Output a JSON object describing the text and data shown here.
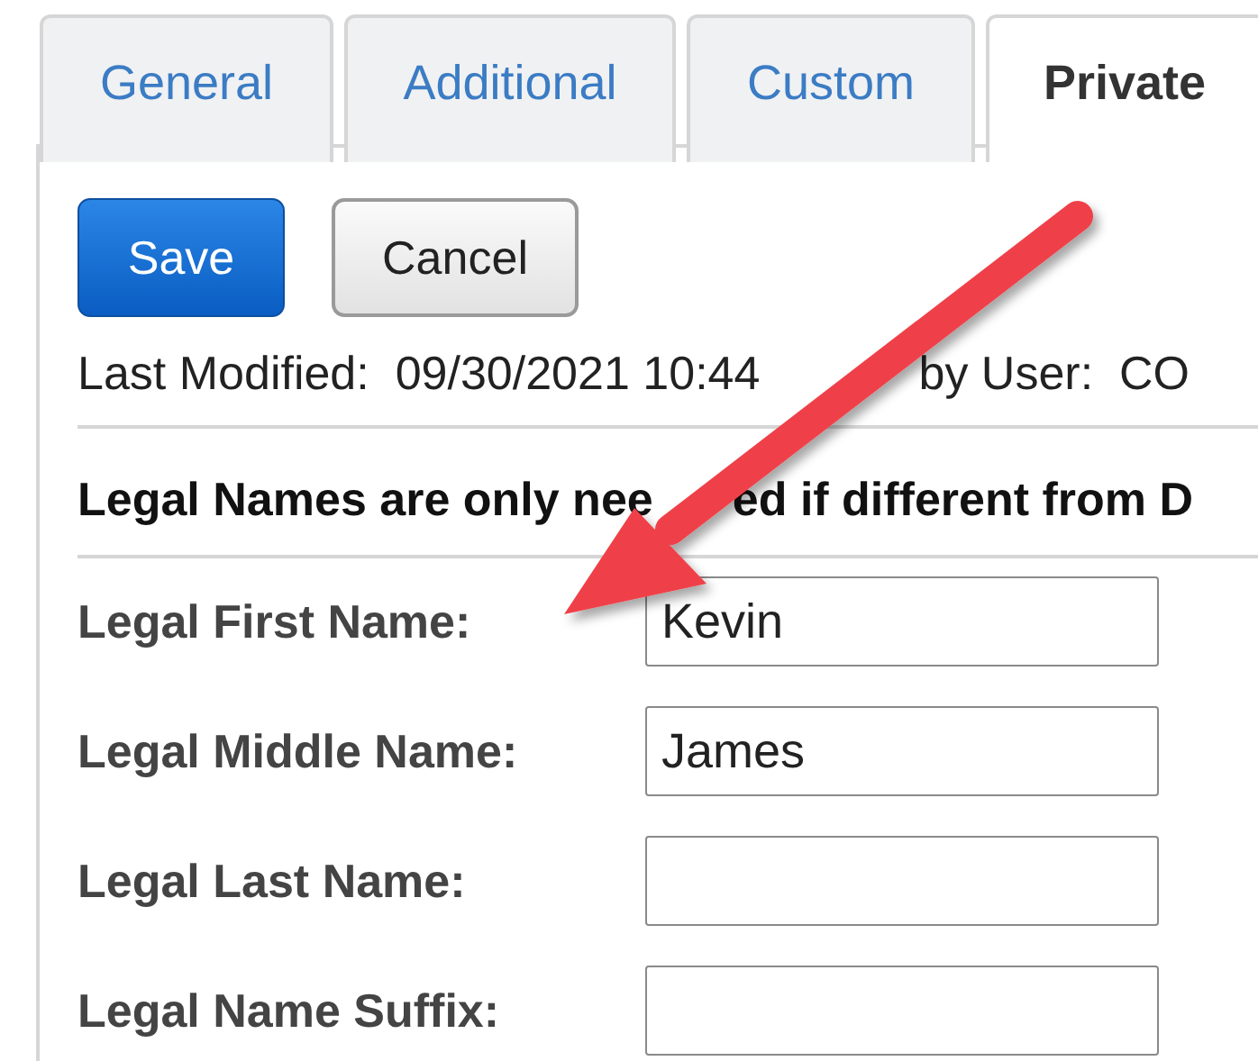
{
  "tabs": [
    {
      "label": "General",
      "selected": false
    },
    {
      "label": "Additional",
      "selected": false
    },
    {
      "label": "Custom",
      "selected": false
    },
    {
      "label": "Private",
      "selected": true
    }
  ],
  "buttons": [
    {
      "label": "Save",
      "kind": "primary"
    },
    {
      "label": "Cancel",
      "kind": "secondary"
    }
  ],
  "last_modified": [
    "Last Modified:  09/30/2021 10:44",
    "by User:  CO"
  ],
  "notice": [
    "Legal Names are only nee",
    "ed if different from D"
  ],
  "fields": [
    {
      "label": "Legal First Name:",
      "value": "Kevin"
    },
    {
      "label": "Legal Middle Name:",
      "value": "James"
    },
    {
      "label": "Legal Last Name:"
    },
    {
      "label": "Legal Name Suffix:"
    }
  ]
}
